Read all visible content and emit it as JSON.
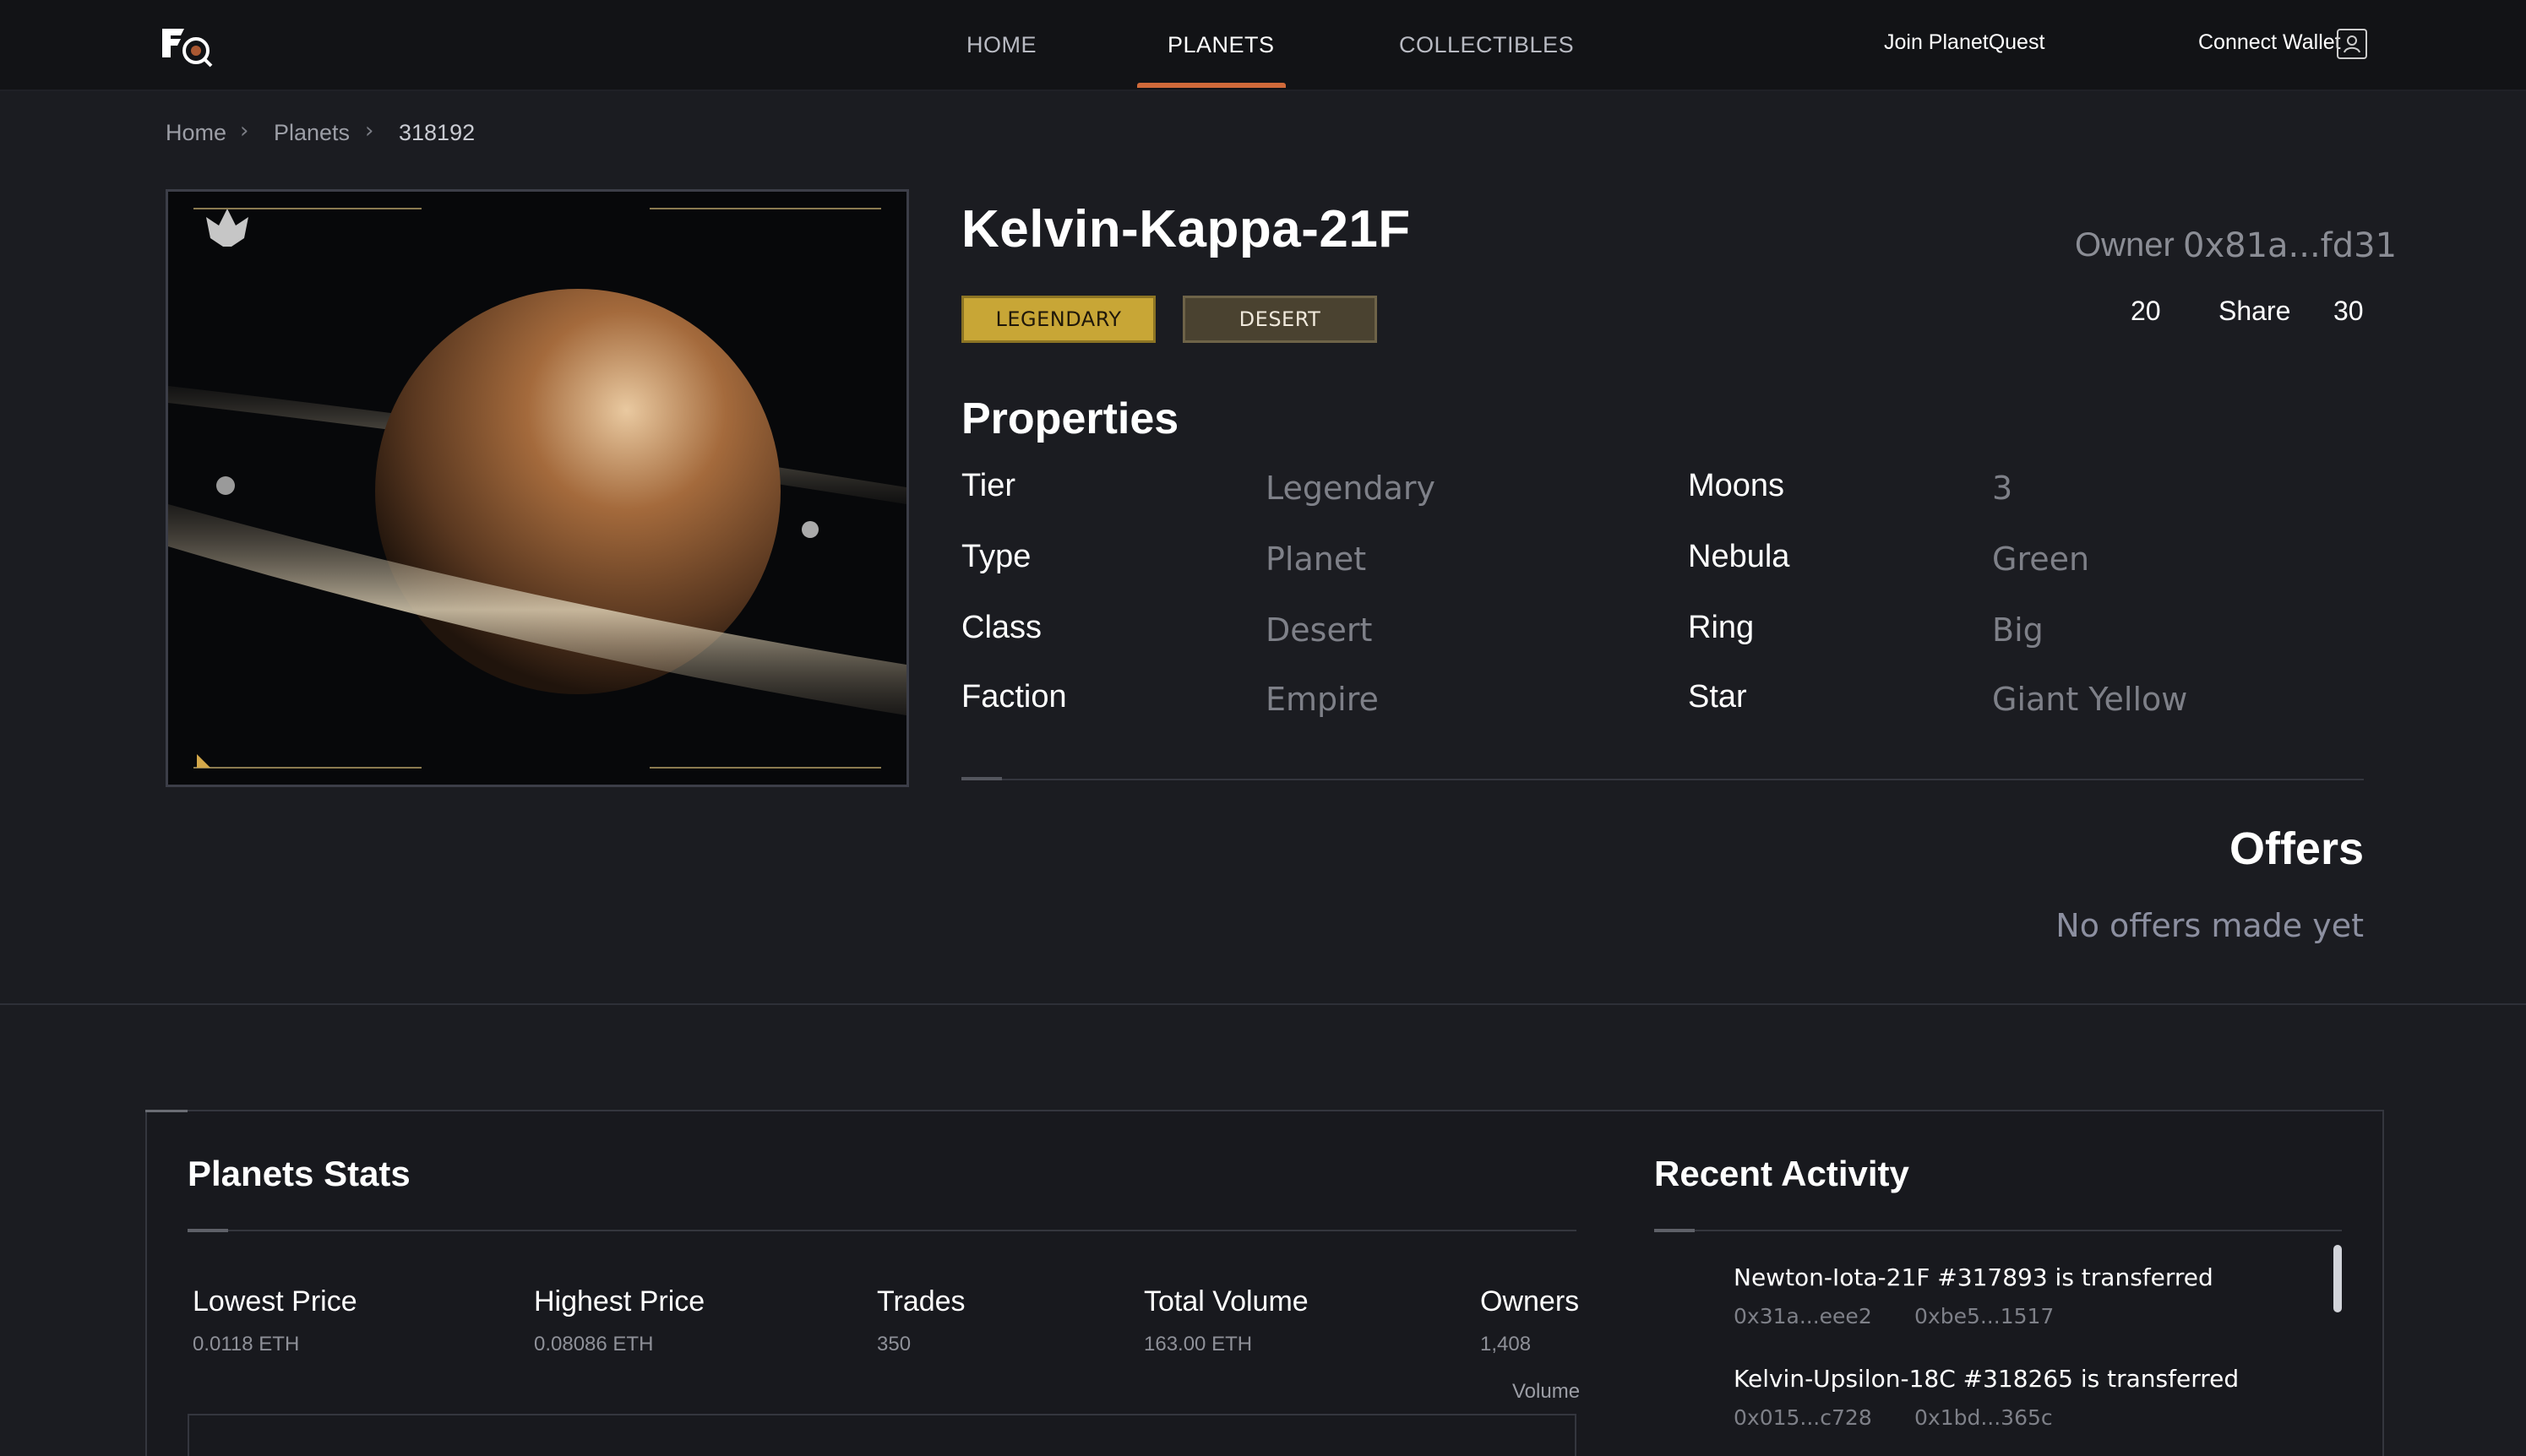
{
  "nav": {
    "links": [
      "HOME",
      "PLANETS",
      "COLLECTIBLES"
    ],
    "active": "PLANETS",
    "join": "Join PlanetQuest",
    "connect": "Connect Wallet"
  },
  "breadcrumb": [
    "Home",
    "Planets",
    "318192"
  ],
  "planet": {
    "name": "Kelvin-Kappa-21F",
    "tags": [
      "LEGENDARY",
      "DESERT"
    ],
    "owner_label": "Owner",
    "owner": "0x81a...fd31",
    "share_left": "20",
    "share_label": "Share",
    "share_right": "30"
  },
  "properties": {
    "title": "Properties",
    "left": [
      {
        "label": "Tier",
        "value": "Legendary"
      },
      {
        "label": "Type",
        "value": "Planet"
      },
      {
        "label": "Class",
        "value": "Desert"
      },
      {
        "label": "Faction",
        "value": "Empire"
      }
    ],
    "right": [
      {
        "label": "Moons",
        "value": "3"
      },
      {
        "label": "Nebula",
        "value": "Green"
      },
      {
        "label": "Ring",
        "value": "Big"
      },
      {
        "label": "Star",
        "value": "Giant Yellow"
      }
    ]
  },
  "offers": {
    "title": "Offers",
    "empty": "No offers made yet"
  },
  "stats": {
    "title": "Planets Stats",
    "items": [
      {
        "label": "Lowest Price",
        "value": "0.0118 ETH"
      },
      {
        "label": "Highest Price",
        "value": "0.08086 ETH"
      },
      {
        "label": "Trades",
        "value": "350"
      },
      {
        "label": "Total Volume",
        "value": "163.00 ETH"
      },
      {
        "label": "Owners",
        "value": "1,408"
      }
    ],
    "chart_label": "Volume"
  },
  "activity": {
    "title": "Recent Activity",
    "items": [
      {
        "text": "Newton-Iota-21F #317893 is transferred",
        "from": "0x31a...eee2",
        "to": "0xbe5...1517"
      },
      {
        "text": "Kelvin-Upsilon-18C #318265 is transferred",
        "from": "0x015...c728",
        "to": "0x1bd...365c"
      }
    ]
  },
  "colors": {
    "accent": "#d06a3a",
    "legendary": "#c8a636",
    "desert": "#4a4230",
    "background": "#1b1c21"
  }
}
